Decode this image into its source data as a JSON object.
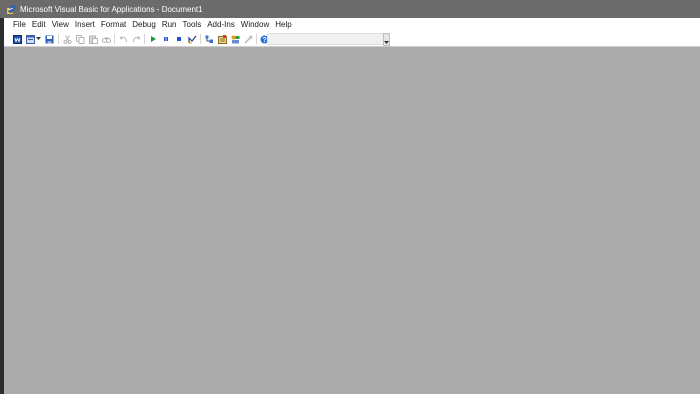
{
  "window": {
    "title": "Microsoft Visual Basic for Applications - Document1"
  },
  "menu": {
    "items": [
      {
        "label": "File"
      },
      {
        "label": "Edit"
      },
      {
        "label": "View"
      },
      {
        "label": "Insert"
      },
      {
        "label": "Format"
      },
      {
        "label": "Debug"
      },
      {
        "label": "Run"
      },
      {
        "label": "Tools"
      },
      {
        "label": "Add-Ins"
      },
      {
        "label": "Window"
      },
      {
        "label": "Help"
      }
    ]
  },
  "toolbar": {
    "icons": [
      "view-word-icon",
      "insert-userform-icon",
      "save-icon",
      "cut-icon",
      "copy-icon",
      "paste-icon",
      "find-icon",
      "undo-icon",
      "redo-icon",
      "run-icon",
      "break-icon",
      "reset-icon",
      "design-mode-icon",
      "project-explorer-icon",
      "properties-window-icon",
      "object-browser-icon",
      "toolbox-icon",
      "help-icon"
    ]
  },
  "colors": {
    "titlebar_bg": "#6b6b6b",
    "workspace_bg": "#ababab",
    "run_green": "#1a9b2a",
    "stop_blue": "#1f4fd6",
    "help_blue": "#2a6fd6"
  }
}
